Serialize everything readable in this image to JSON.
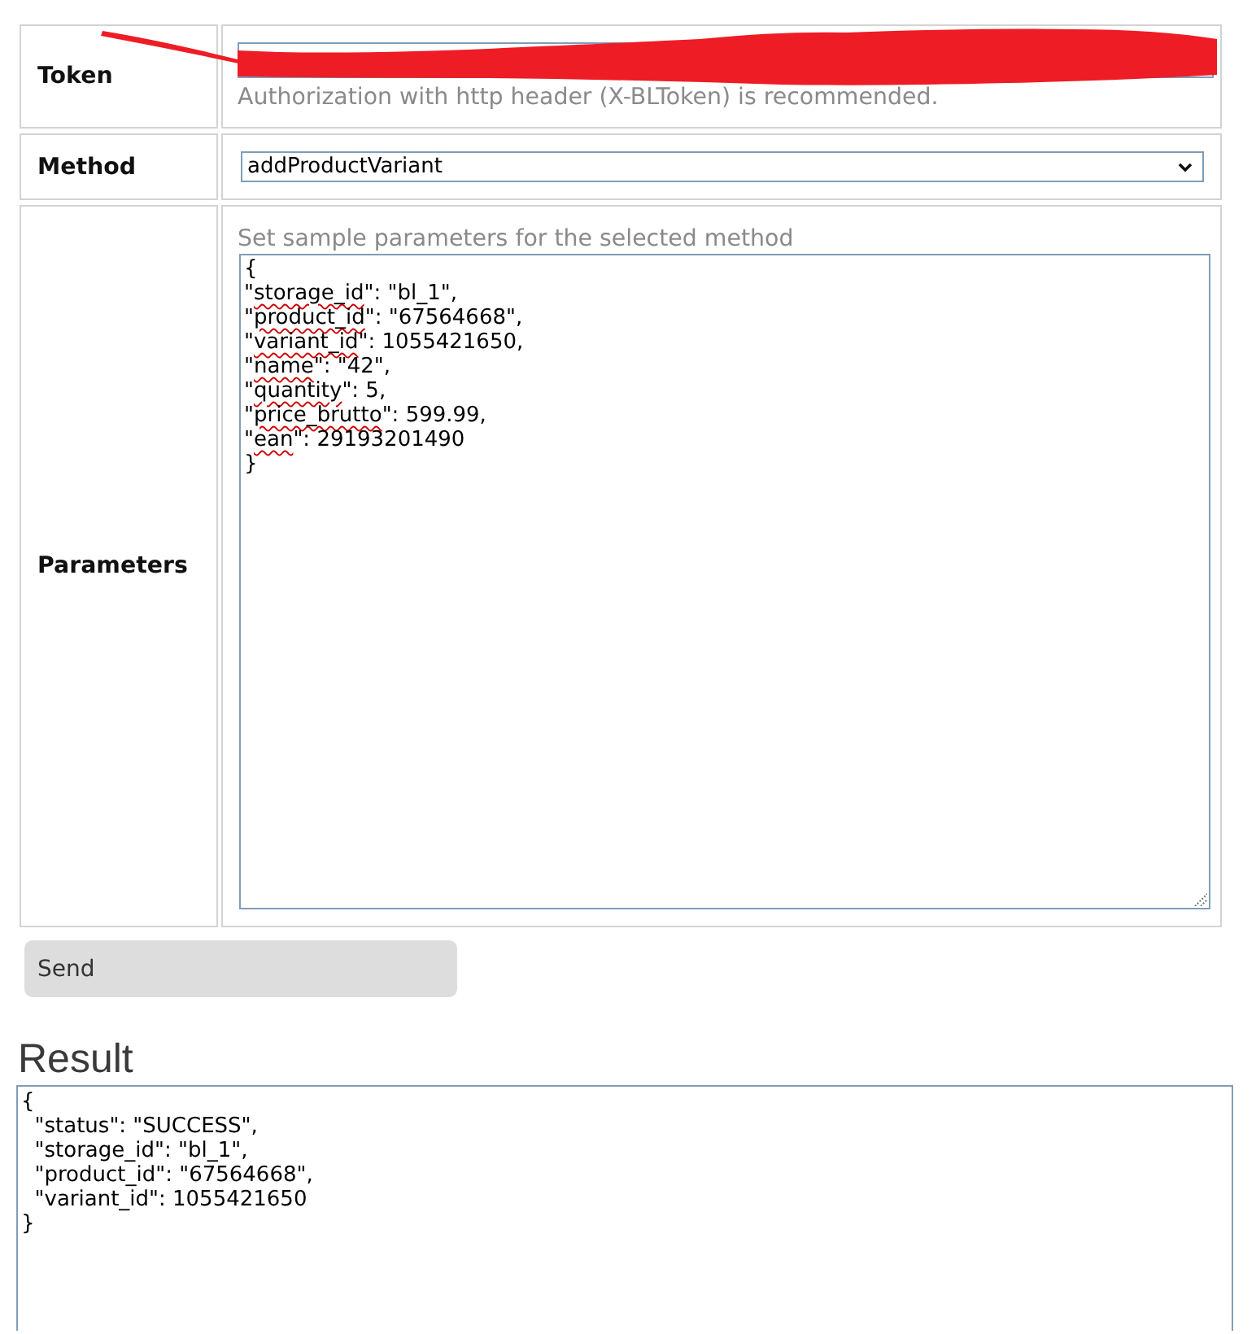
{
  "form": {
    "rows": [
      {
        "kind": "token",
        "label": "Token",
        "redacted": true,
        "hint": "Authorization with http header (X-BLToken) is recommended."
      },
      {
        "kind": "select",
        "label": "Method",
        "value": "addProductVariant"
      },
      {
        "kind": "textarea",
        "label": "Parameters",
        "hint": "Set sample parameters for the selected method",
        "lines": [
          {
            "segments": [
              {
                "text": "{",
                "misspelled": false
              }
            ]
          },
          {
            "segments": [
              {
                "text": "\"",
                "misspelled": false
              },
              {
                "text": "storage_id",
                "misspelled": true
              },
              {
                "text": "\": \"bl_1\",",
                "misspelled": false
              }
            ]
          },
          {
            "segments": [
              {
                "text": "\"",
                "misspelled": false
              },
              {
                "text": "product_id",
                "misspelled": true
              },
              {
                "text": "\": \"67564668\",",
                "misspelled": false
              }
            ]
          },
          {
            "segments": [
              {
                "text": "\"",
                "misspelled": false
              },
              {
                "text": "variant_id",
                "misspelled": true
              },
              {
                "text": "\": 1055421650,",
                "misspelled": false
              }
            ]
          },
          {
            "segments": [
              {
                "text": "\"",
                "misspelled": false
              },
              {
                "text": "name",
                "misspelled": true
              },
              {
                "text": "\": \"42\",",
                "misspelled": false
              }
            ]
          },
          {
            "segments": [
              {
                "text": "\"",
                "misspelled": false
              },
              {
                "text": "quantity",
                "misspelled": true
              },
              {
                "text": "\": 5,",
                "misspelled": false
              }
            ]
          },
          {
            "segments": [
              {
                "text": "\"",
                "misspelled": false
              },
              {
                "text": "price_brutto",
                "misspelled": true
              },
              {
                "text": "\": 599.99,",
                "misspelled": false
              }
            ]
          },
          {
            "segments": [
              {
                "text": "\"",
                "misspelled": false
              },
              {
                "text": "ean",
                "misspelled": true
              },
              {
                "text": "\": 29193201490",
                "misspelled": false
              }
            ]
          },
          {
            "segments": [
              {
                "text": "}",
                "misspelled": false
              }
            ]
          }
        ]
      }
    ]
  },
  "send_button": {
    "label": "Send"
  },
  "result": {
    "title": "Result",
    "lines": [
      "{",
      "  \"status\": \"SUCCESS\",",
      "  \"storage_id\": \"bl_1\",",
      "  \"product_id\": \"67564668\",",
      "  \"variant_id\": 1055421650",
      "}"
    ]
  }
}
